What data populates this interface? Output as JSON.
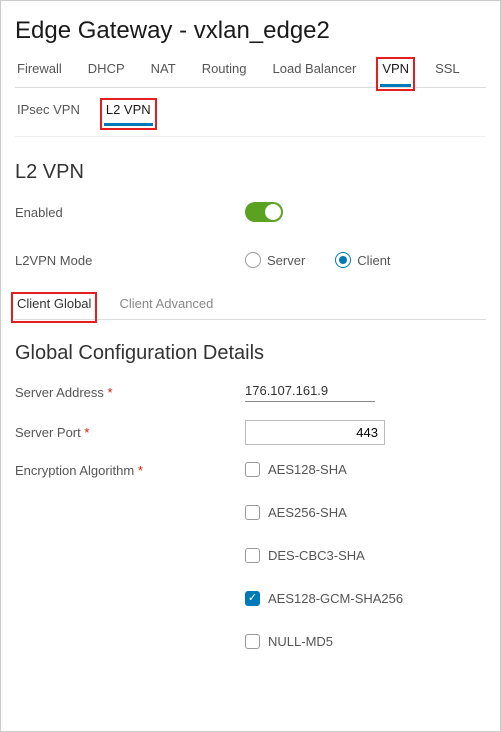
{
  "title": "Edge Gateway - vxlan_edge2",
  "mainTabs": {
    "firewall": "Firewall",
    "dhcp": "DHCP",
    "nat": "NAT",
    "routing": "Routing",
    "loadBalancer": "Load Balancer",
    "vpn": "VPN",
    "ssl": "SSL"
  },
  "subTabs": {
    "ipsec": "IPsec VPN",
    "l2": "L2 VPN"
  },
  "l2section": {
    "heading": "L2 VPN",
    "enabledLabel": "Enabled",
    "modeLabel": "L2VPN Mode",
    "modeOptions": {
      "server": "Server",
      "client": "Client"
    }
  },
  "clientTabs": {
    "global": "Client Global",
    "advanced": "Client Advanced"
  },
  "globalConfig": {
    "heading": "Global Configuration Details",
    "serverAddressLabel": "Server Address",
    "serverAddressValue": "176.107.161.9",
    "serverPortLabel": "Server Port",
    "serverPortValue": "443",
    "encLabel": "Encryption Algorithm",
    "encOptions": [
      {
        "label": "AES128-SHA",
        "checked": false
      },
      {
        "label": "AES256-SHA",
        "checked": false
      },
      {
        "label": "DES-CBC3-SHA",
        "checked": false
      },
      {
        "label": "AES128-GCM-SHA256",
        "checked": true
      },
      {
        "label": "NULL-MD5",
        "checked": false
      }
    ]
  }
}
